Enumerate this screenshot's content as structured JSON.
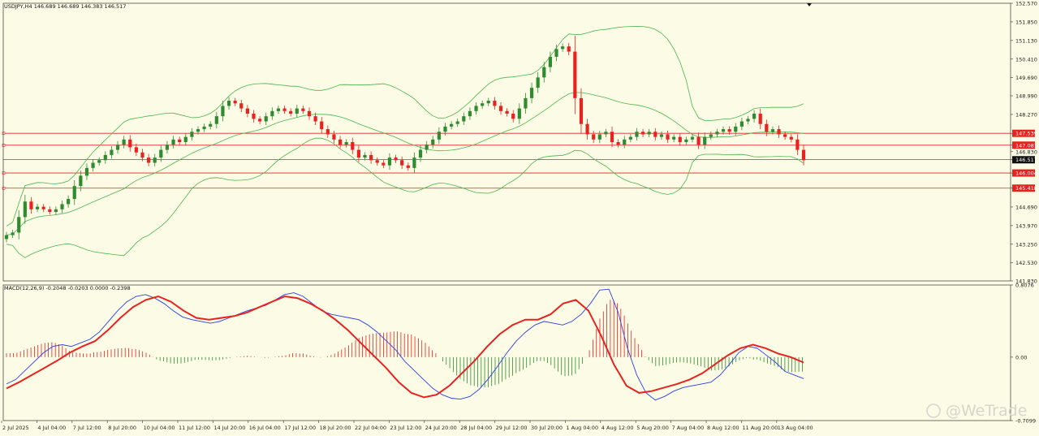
{
  "header": {
    "symbol_line": "USDJPY,H4  146.689 146.689 146.383 146.517"
  },
  "macd_header": {
    "line": "MACD(12,26,9) -0.2048 -0.0203 0.0000 -0.2398"
  },
  "watermark": {
    "text": "@WeTrade"
  },
  "colors": {
    "bull": "#2e8b2e",
    "bear": "#e8231f",
    "band": "#49b649",
    "level": "#e8231f",
    "macd_main": "#2a3fe0",
    "macd_signal": "#e8231f",
    "background": "#fbfbe6"
  },
  "chart_data": [
    {
      "type": "candlestick",
      "title": "",
      "ylim": [
        141.83,
        152.57
      ],
      "y_ticks": [
        "152.570",
        "151.850",
        "151.130",
        "150.410",
        "149.690",
        "148.990",
        "148.270",
        "147.539",
        "147.081",
        "146.830",
        "146.517",
        "146.004",
        "145.418",
        "144.690",
        "143.970",
        "143.250",
        "142.530",
        "141.830"
      ],
      "current_price": 146.517,
      "levels": [
        147.539,
        147.081,
        146.004,
        145.418
      ],
      "x_ticks": [
        "2 Jul 2025",
        "4 Jul 04:00",
        "7 Jul 12:00",
        "8 Jul 20:00",
        "10 Jul 04:00",
        "11 Jul 12:00",
        "14 Jul 20:00",
        "16 Jul 04:00",
        "17 Jul 12:00",
        "18 Jul 20:00",
        "22 Jul 04:00",
        "23 Jul 12:00",
        "24 Jul 20:00",
        "28 Jul 04:00",
        "29 Jul 12:00",
        "30 Jul 20:00",
        "1 Aug 04:00",
        "4 Aug 12:00",
        "5 Aug 20:00",
        "7 Aug 04:00",
        "8 Aug 12:00",
        "11 Aug 20:00",
        "13 Aug 04:00"
      ],
      "close": [
        143.6,
        143.7,
        144.3,
        144.9,
        144.6,
        144.7,
        144.6,
        144.5,
        144.6,
        144.8,
        145.0,
        145.5,
        145.9,
        146.2,
        146.4,
        146.5,
        146.7,
        146.9,
        147.1,
        147.3,
        147.0,
        146.8,
        146.6,
        146.4,
        146.6,
        146.9,
        147.1,
        147.3,
        147.2,
        147.4,
        147.6,
        147.7,
        147.8,
        147.9,
        148.2,
        148.6,
        148.8,
        148.7,
        148.5,
        148.3,
        148.1,
        148.0,
        148.2,
        148.4,
        148.5,
        148.4,
        148.3,
        148.5,
        148.4,
        148.2,
        148.0,
        147.7,
        147.5,
        147.3,
        147.1,
        147.2,
        146.9,
        146.6,
        146.7,
        146.5,
        146.4,
        146.3,
        146.6,
        146.5,
        146.3,
        146.2,
        146.6,
        146.9,
        147.1,
        147.3,
        147.6,
        147.8,
        147.9,
        148.0,
        148.2,
        148.4,
        148.6,
        148.7,
        148.8,
        148.6,
        148.4,
        148.3,
        148.1,
        148.5,
        148.9,
        149.3,
        149.7,
        150.1,
        150.5,
        150.8,
        150.9,
        150.7,
        148.9,
        147.9,
        147.5,
        147.3,
        147.5,
        147.6,
        147.2,
        147.1,
        147.3,
        147.4,
        147.6,
        147.5,
        147.6,
        147.4,
        147.5,
        147.3,
        147.4,
        147.2,
        147.3,
        147.4,
        147.1,
        147.4,
        147.5,
        147.6,
        147.7,
        147.6,
        147.8,
        148.0,
        148.1,
        148.3,
        147.9,
        147.6,
        147.7,
        147.5,
        147.4,
        147.3,
        146.9,
        146.5
      ]
    },
    {
      "type": "macd",
      "title": "",
      "ylim": [
        -0.7099,
        0.8076
      ],
      "y_ticks": [
        "0.8076",
        "0.00",
        "-0.7099"
      ],
      "macd": [
        -0.3,
        -0.25,
        -0.15,
        -0.05,
        0.05,
        0.12,
        0.14,
        0.12,
        0.16,
        0.2,
        0.28,
        0.4,
        0.52,
        0.62,
        0.68,
        0.7,
        0.66,
        0.6,
        0.52,
        0.45,
        0.42,
        0.4,
        0.38,
        0.4,
        0.44,
        0.48,
        0.52,
        0.55,
        0.58,
        0.64,
        0.7,
        0.72,
        0.68,
        0.6,
        0.52,
        0.48,
        0.46,
        0.44,
        0.42,
        0.36,
        0.28,
        0.18,
        0.08,
        -0.05,
        -0.15,
        -0.25,
        -0.35,
        -0.42,
        -0.46,
        -0.47,
        -0.44,
        -0.36,
        -0.24,
        -0.1,
        0.05,
        0.18,
        0.28,
        0.36,
        0.4,
        0.38,
        0.36,
        0.4,
        0.48,
        0.6,
        0.75,
        0.76,
        0.5,
        0.1,
        -0.2,
        -0.4,
        -0.48,
        -0.44,
        -0.38,
        -0.34,
        -0.32,
        -0.3,
        -0.28,
        -0.2,
        -0.08,
        0.05,
        0.12,
        0.1,
        0.02,
        -0.06,
        -0.16,
        -0.2,
        -0.24
      ],
      "signal": [
        -0.35,
        -0.28,
        -0.2,
        -0.12,
        -0.04,
        0.05,
        0.12,
        0.18,
        0.3,
        0.44,
        0.56,
        0.64,
        0.68,
        0.62,
        0.52,
        0.44,
        0.42,
        0.44,
        0.46,
        0.5,
        0.56,
        0.62,
        0.68,
        0.66,
        0.6,
        0.52,
        0.42,
        0.3,
        0.16,
        0.02,
        -0.12,
        -0.28,
        -0.4,
        -0.45,
        -0.42,
        -0.32,
        -0.18,
        -0.04,
        0.12,
        0.26,
        0.36,
        0.42,
        0.42,
        0.48,
        0.6,
        0.64,
        0.52,
        0.24,
        -0.08,
        -0.32,
        -0.4,
        -0.38,
        -0.34,
        -0.3,
        -0.25,
        -0.18,
        -0.08,
        0.02,
        0.1,
        0.14,
        0.1,
        0.04,
        0.0,
        -0.06
      ]
    }
  ]
}
